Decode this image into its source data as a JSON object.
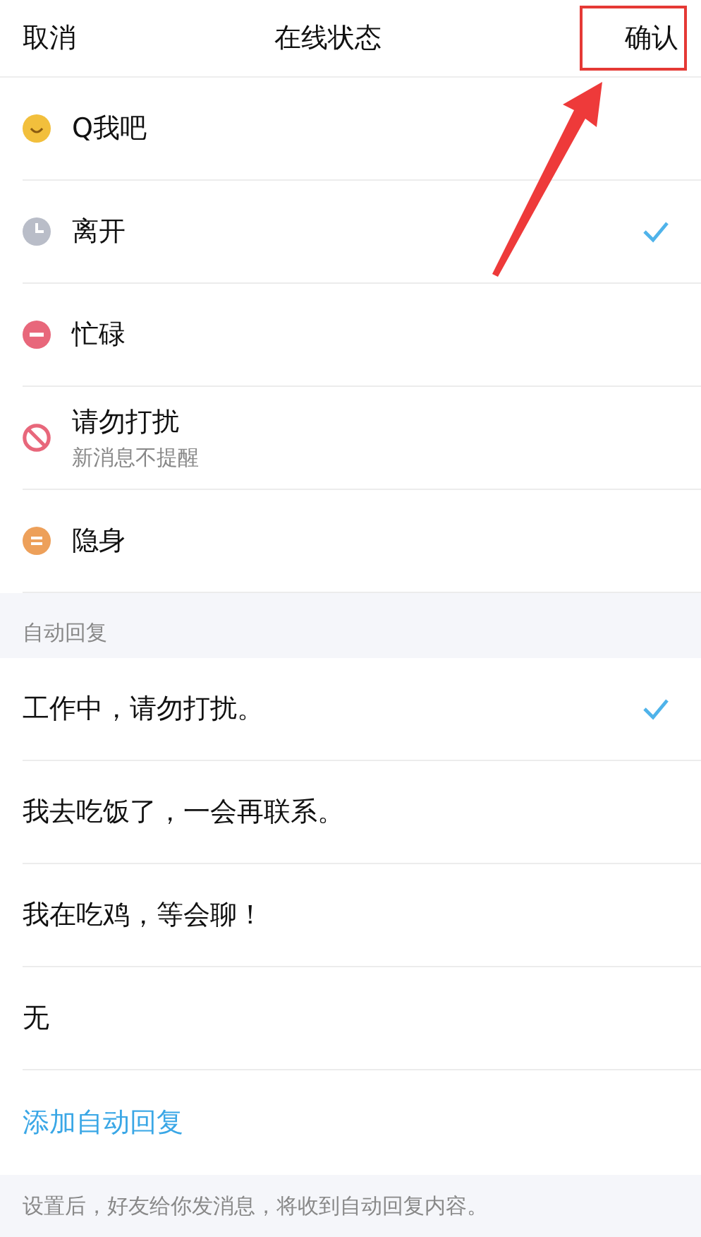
{
  "header": {
    "cancel": "取消",
    "title": "在线状态",
    "confirm": "确认",
    "confirm_highlighted": true
  },
  "statuses": [
    {
      "label": "Q我吧",
      "kind": "smile",
      "color": "#f2bf3c",
      "selected": false
    },
    {
      "label": "离开",
      "kind": "clock",
      "color": "#b9bdc8",
      "selected": true
    },
    {
      "label": "忙碌",
      "kind": "minus",
      "color": "#e8677b",
      "selected": false
    },
    {
      "label": "请勿打扰",
      "sublabel": "新消息不提醒",
      "kind": "forbidden",
      "color": "#e8677b",
      "selected": false
    },
    {
      "label": "隐身",
      "kind": "equals",
      "color": "#eda05a",
      "selected": false
    }
  ],
  "auto_reply": {
    "heading": "自动回复",
    "options": [
      {
        "label": "工作中，请勿打扰。",
        "selected": true
      },
      {
        "label": "我去吃饭了，一会再联系。",
        "selected": false
      },
      {
        "label": "我在吃鸡，等会聊！",
        "selected": false
      },
      {
        "label": "无",
        "selected": false
      }
    ],
    "add_link": "添加自动回复",
    "footer": "设置后，好友给你发消息，将收到自动回复内容。"
  }
}
